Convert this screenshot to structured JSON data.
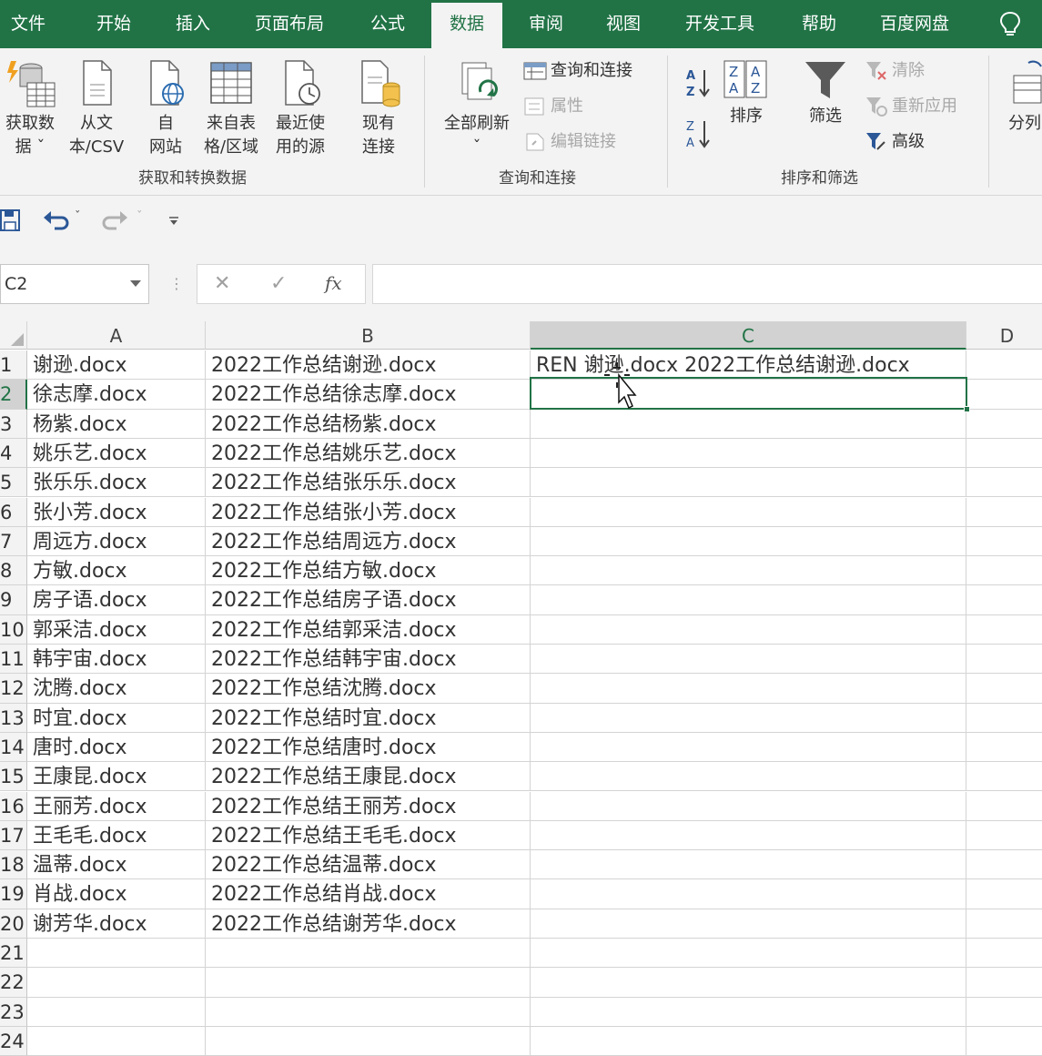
{
  "tabs": [
    {
      "label": "文件",
      "active": false
    },
    {
      "label": "开始",
      "active": false
    },
    {
      "label": "插入",
      "active": false
    },
    {
      "label": "页面布局",
      "active": false
    },
    {
      "label": "公式",
      "active": false
    },
    {
      "label": "数据",
      "active": true
    },
    {
      "label": "审阅",
      "active": false
    },
    {
      "label": "视图",
      "active": false
    },
    {
      "label": "开发工具",
      "active": false
    },
    {
      "label": "帮助",
      "active": false
    },
    {
      "label": "百度网盘",
      "active": false
    }
  ],
  "ribbon": {
    "get_data": {
      "line1": "获取数",
      "line2": "据 ˇ"
    },
    "from_text": {
      "line1": "从文",
      "line2": "本/CSV"
    },
    "from_web": {
      "line1": "自",
      "line2": "网站"
    },
    "from_table": {
      "line1": "来自表",
      "line2": "格/区域"
    },
    "recent": {
      "line1": "最近使",
      "line2": "用的源"
    },
    "existing": {
      "line1": "现有",
      "line2": "连接"
    },
    "group1_label": "获取和转换数据",
    "refresh_all": {
      "line1": "全部刷新",
      "line2": "ˇ"
    },
    "queries": "查询和连接",
    "properties": "属性",
    "edit_links": "编辑链接",
    "group2_label": "查询和连接",
    "sort": "排序",
    "filter": "筛选",
    "clear": "清除",
    "reapply": "重新应用",
    "advanced": "高级",
    "group3_label": "排序和筛选",
    "split": "分列"
  },
  "formula_bar": {
    "name_box": "C2",
    "fx": "fx",
    "value": ""
  },
  "columns": [
    "A",
    "B",
    "C",
    "D"
  ],
  "selected_column": "C",
  "selected_row": "2",
  "rows": [
    {
      "n": "1",
      "a": "谢逊.docx",
      "b": "2022工作总结谢逊.docx",
      "c": "REN 谢逊.docx 2022工作总结谢逊.docx"
    },
    {
      "n": "2",
      "a": "徐志摩.docx",
      "b": "2022工作总结徐志摩.docx",
      "c": ""
    },
    {
      "n": "3",
      "a": "杨紫.docx",
      "b": "2022工作总结杨紫.docx",
      "c": ""
    },
    {
      "n": "4",
      "a": "姚乐艺.docx",
      "b": "2022工作总结姚乐艺.docx",
      "c": ""
    },
    {
      "n": "5",
      "a": "张乐乐.docx",
      "b": "2022工作总结张乐乐.docx",
      "c": ""
    },
    {
      "n": "6",
      "a": "张小芳.docx",
      "b": "2022工作总结张小芳.docx",
      "c": ""
    },
    {
      "n": "7",
      "a": "周远方.docx",
      "b": "2022工作总结周远方.docx",
      "c": ""
    },
    {
      "n": "8",
      "a": "方敏.docx",
      "b": "2022工作总结方敏.docx",
      "c": ""
    },
    {
      "n": "9",
      "a": "房子语.docx",
      "b": "2022工作总结房子语.docx",
      "c": ""
    },
    {
      "n": "10",
      "a": "郭采洁.docx",
      "b": "2022工作总结郭采洁.docx",
      "c": ""
    },
    {
      "n": "11",
      "a": "韩宇宙.docx",
      "b": "2022工作总结韩宇宙.docx",
      "c": ""
    },
    {
      "n": "12",
      "a": "沈腾.docx",
      "b": "2022工作总结沈腾.docx",
      "c": ""
    },
    {
      "n": "13",
      "a": "时宜.docx",
      "b": "2022工作总结时宜.docx",
      "c": ""
    },
    {
      "n": "14",
      "a": "唐时.docx",
      "b": "2022工作总结唐时.docx",
      "c": ""
    },
    {
      "n": "15",
      "a": "王康昆.docx",
      "b": "2022工作总结王康昆.docx",
      "c": ""
    },
    {
      "n": "16",
      "a": "王丽芳.docx",
      "b": "2022工作总结王丽芳.docx",
      "c": ""
    },
    {
      "n": "17",
      "a": "王毛毛.docx",
      "b": "2022工作总结王毛毛.docx",
      "c": ""
    },
    {
      "n": "18",
      "a": "温蒂.docx",
      "b": "2022工作总结温蒂.docx",
      "c": ""
    },
    {
      "n": "19",
      "a": "肖战.docx",
      "b": "2022工作总结肖战.docx",
      "c": ""
    },
    {
      "n": "20",
      "a": "谢芳华.docx",
      "b": "2022工作总结谢芳华.docx",
      "c": ""
    },
    {
      "n": "21",
      "a": "",
      "b": "",
      "c": ""
    },
    {
      "n": "22",
      "a": "",
      "b": "",
      "c": ""
    },
    {
      "n": "23",
      "a": "",
      "b": "",
      "c": ""
    },
    {
      "n": "24",
      "a": "",
      "b": "",
      "c": ""
    }
  ],
  "colors": {
    "accent": "#217346",
    "ribbon_bg": "#f3f3f3",
    "grid_line": "#d4d4d4"
  }
}
